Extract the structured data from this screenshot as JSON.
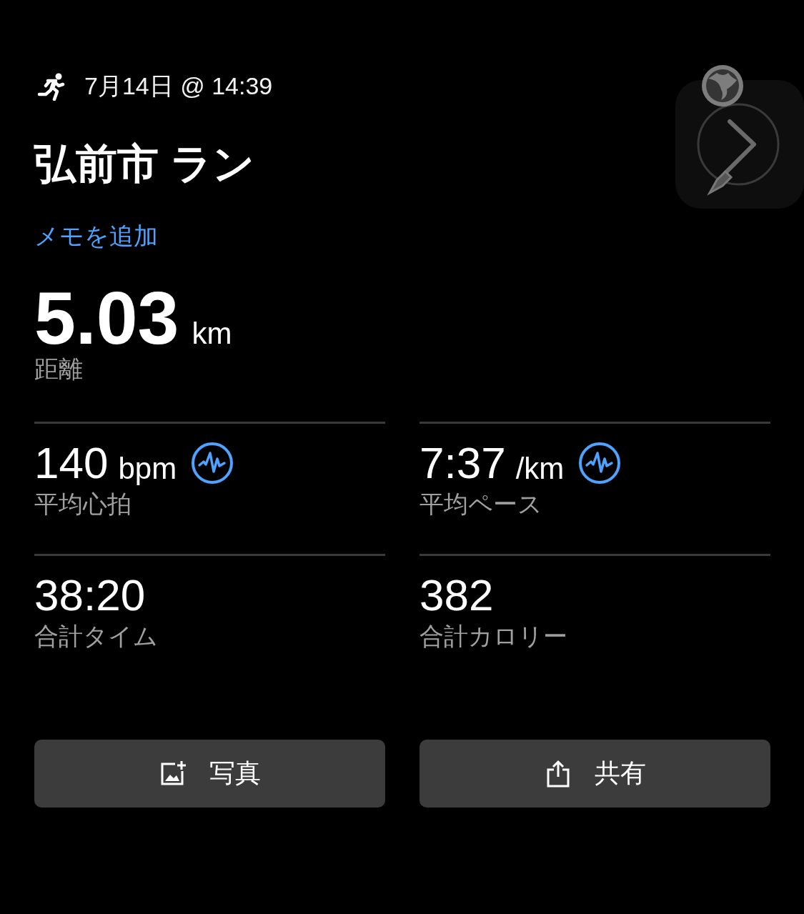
{
  "header": {
    "date": "7月14日 @ 14:39"
  },
  "title": "弘前市 ラン",
  "memo_link": "メモを追加",
  "distance": {
    "value": "5.03",
    "unit": "km",
    "label": "距離"
  },
  "stats": [
    {
      "value": "140",
      "unit": "bpm",
      "label": "平均心拍",
      "zone_icon": true
    },
    {
      "value": "7:37",
      "unit": "/km",
      "label": "平均ペース",
      "zone_icon": true
    },
    {
      "value": "38:20",
      "label": "合計タイム",
      "zone_icon": false
    },
    {
      "value": "382",
      "label": "合計カロリー",
      "zone_icon": false
    }
  ],
  "buttons": [
    {
      "kind": "photo",
      "label": "写真"
    },
    {
      "kind": "share",
      "label": "共有"
    }
  ]
}
